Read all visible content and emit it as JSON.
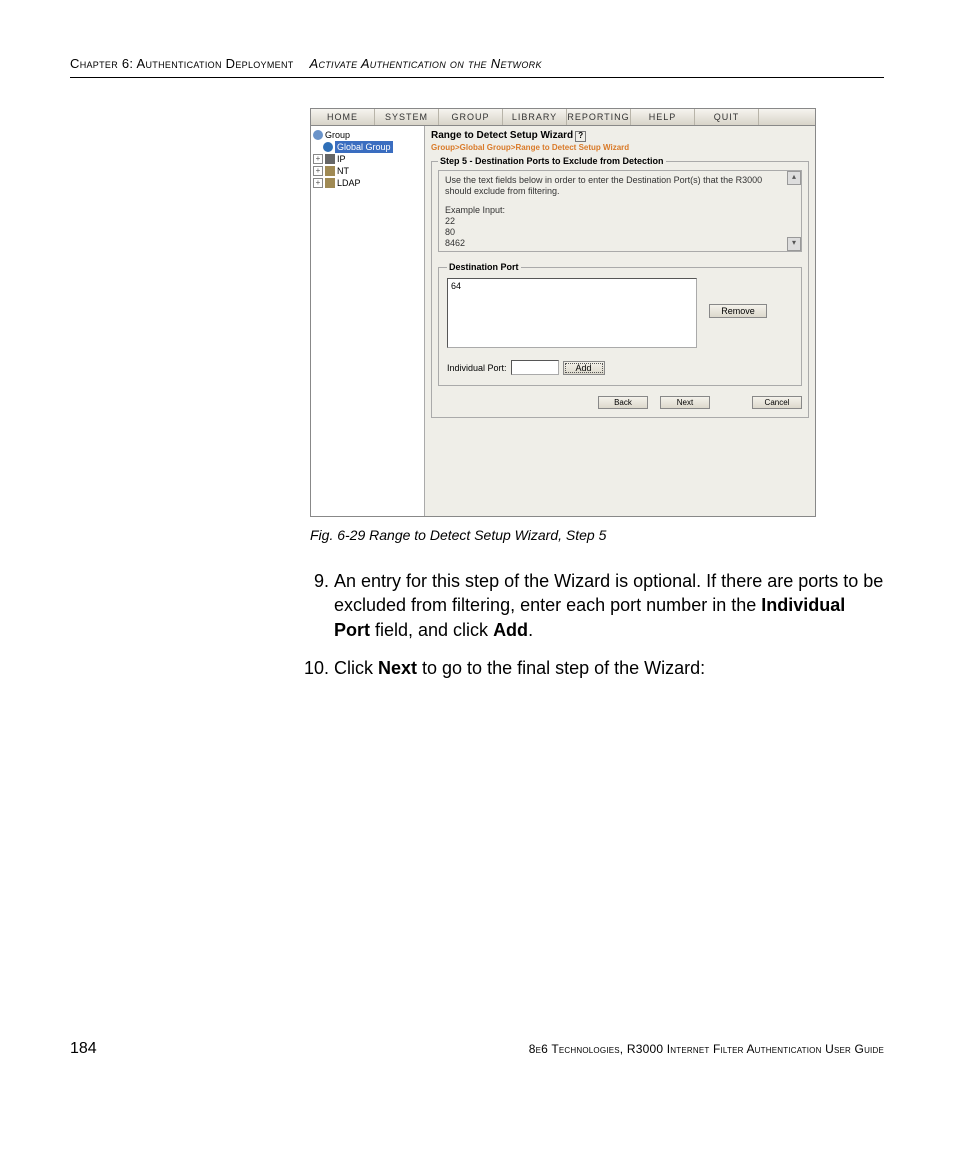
{
  "header": {
    "chapter": "Chapter 6: Authentication Deployment",
    "section": "Activate Authentication on the Network"
  },
  "caption": "Fig. 6-29  Range to Detect Setup Wizard, Step 5",
  "app": {
    "menu": {
      "home": "HOME",
      "system": "SYSTEM",
      "group": "GROUP",
      "library": "LIBRARY",
      "reporting": "REPORTING",
      "help": "HELP",
      "quit": "QUIT"
    },
    "tree": {
      "root": "Group",
      "global": "Global Group",
      "ip": "IP",
      "nt": "NT",
      "ldap": "LDAP"
    },
    "wizard": {
      "title": "Range to Detect Setup Wizard",
      "crumb": "Group>Global Group>Range to Detect Setup Wizard",
      "legend": "Step 5 - Destination Ports to Exclude from Detection",
      "instr1": "Use the text fields below in order to enter the Destination Port(s) that the R3000",
      "instr2": "should exclude from filtering.",
      "example_label": "Example Input:",
      "ex1": "22",
      "ex2": "80",
      "ex3": "8462",
      "dest_legend": "Destination Port",
      "dest_item": "64",
      "remove": "Remove",
      "indiv_label": "Individual Port:",
      "add": "Add",
      "back": "Back",
      "next": "Next",
      "cancel": "Cancel"
    }
  },
  "list": {
    "nine_a": "An entry for this step of the Wizard is optional. If there are ports to be excluded from filtering, enter each port number in the ",
    "nine_b": "Individual Port",
    "nine_c": " field, and click ",
    "nine_d": "Add",
    "nine_e": ".",
    "ten_a": "Click ",
    "ten_b": "Next",
    "ten_c": " to go to the final step of the Wizard:"
  },
  "footer": {
    "page": "184",
    "guide": "8e6 Technologies, R3000 Internet Filter Authentication User Guide"
  }
}
